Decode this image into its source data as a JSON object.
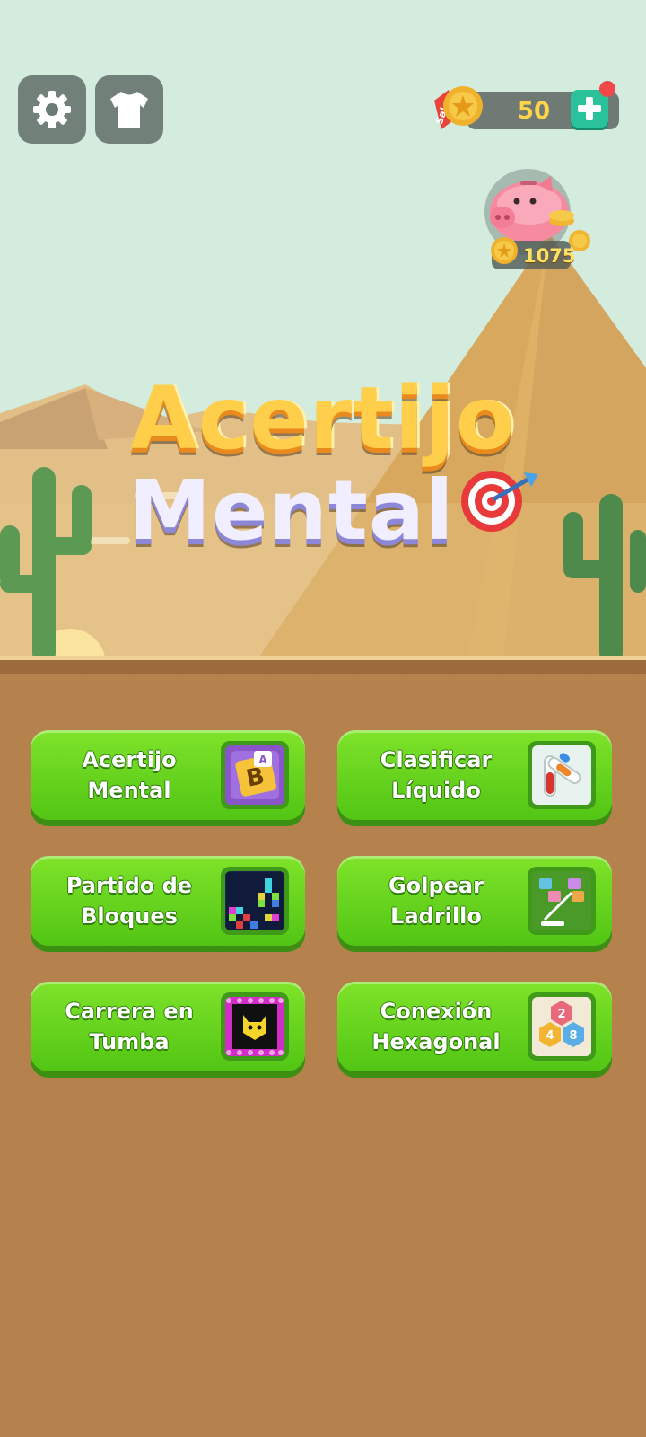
{
  "header": {
    "settings_icon": "gear-icon",
    "shop_icon": "shirt-icon",
    "coins": "50",
    "sale_label": "Sale",
    "piggy_bank_coins": "1075"
  },
  "title": {
    "line1": "Acertijo",
    "line2": "Mental"
  },
  "games": [
    {
      "label": "Acertijo\nMental",
      "icon": "letter-tile-icon",
      "tile_letter": "B",
      "tile_corner": "A"
    },
    {
      "label": "Clasificar\nLíquido",
      "icon": "test-tube-icon"
    },
    {
      "label": "Partido de\nBloques",
      "icon": "block-grid-icon"
    },
    {
      "label": "Golpear\nLadrillo",
      "icon": "brick-breaker-icon"
    },
    {
      "label": "Carrera en\nTumba",
      "icon": "cat-maze-icon"
    },
    {
      "label": "Conexión\nHexagonal",
      "icon": "hexagon-numbers-icon",
      "hex_numbers": [
        "2",
        "4",
        "8"
      ]
    }
  ],
  "colors": {
    "sky": "#d3ecde",
    "sand": "#e6c389",
    "ground": "#b5824d",
    "button_green": "#5fd11c",
    "coin_text": "#ffd54a"
  }
}
